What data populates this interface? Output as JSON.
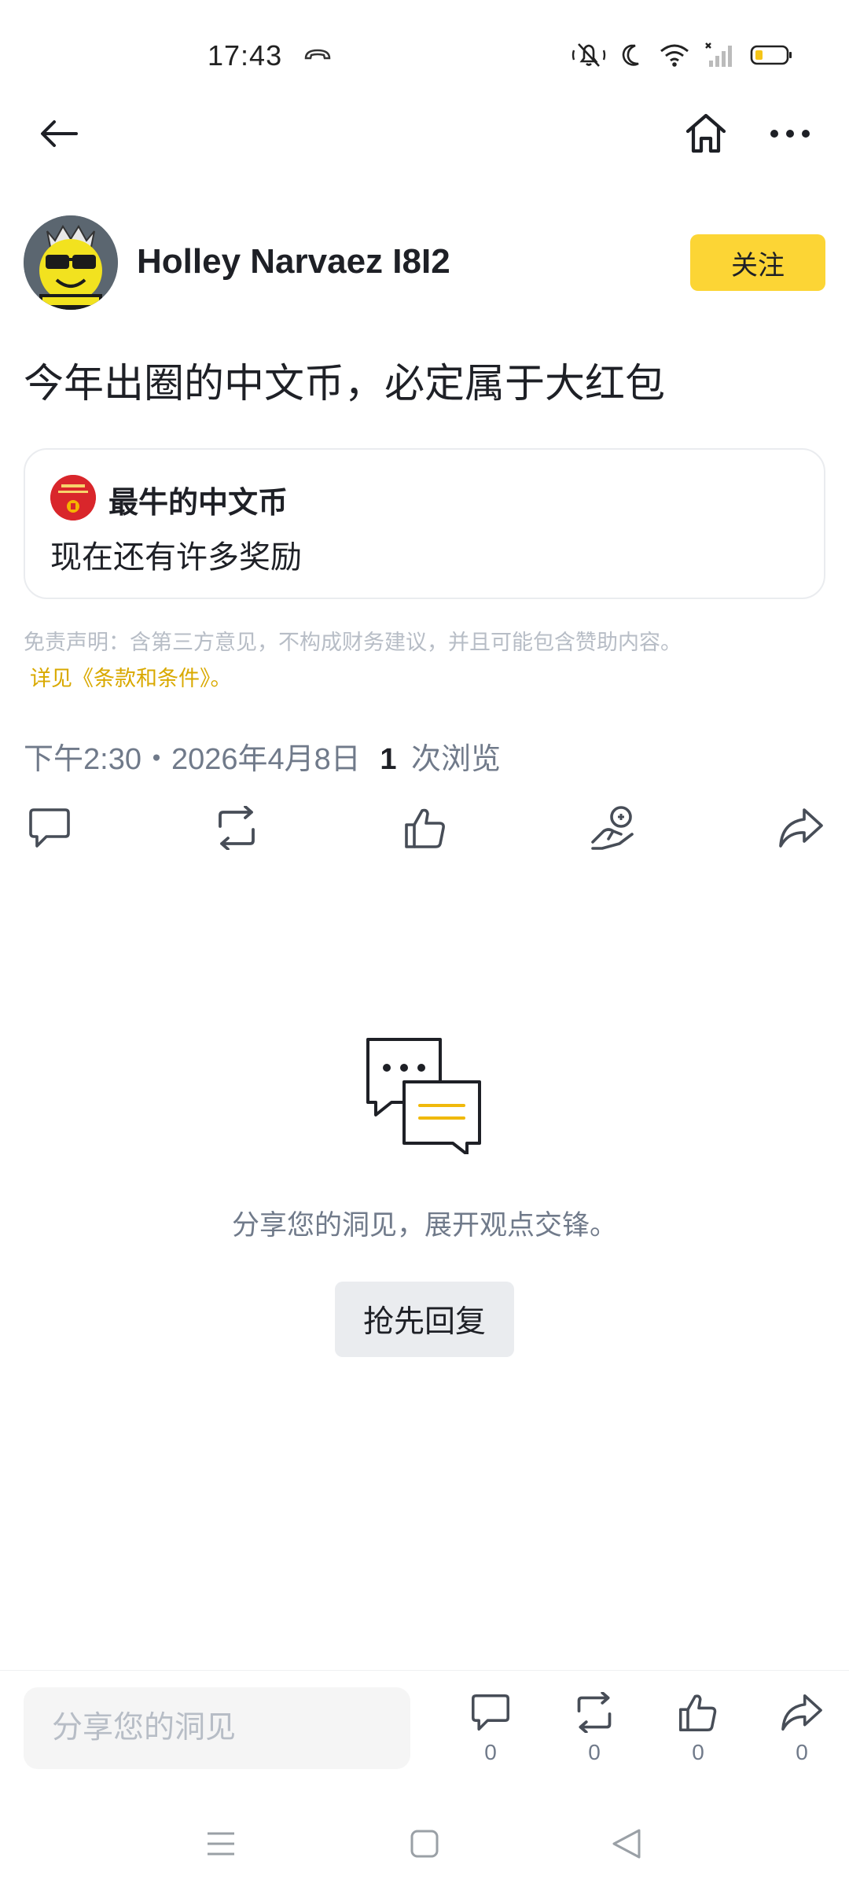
{
  "status_bar": {
    "time": "17:43",
    "icons": [
      "call-icon",
      "mute-icon",
      "moon-icon",
      "wifi-icon",
      "signal-icon",
      "battery-icon"
    ]
  },
  "top_bar": {
    "icons": [
      "back-arrow-icon",
      "home-icon",
      "more-icon"
    ]
  },
  "author": {
    "name": "Holley Narvaez I8I2",
    "follow_label": "关注"
  },
  "post": {
    "text": "今年出圈的中文币，必定属于大红包",
    "quote": {
      "title": "最牛的中文币",
      "subtitle": "现在还有许多奖励"
    },
    "disclaimer": "免责声明：含第三方意见，不构成财务建议，并且可能包含赞助内容。",
    "disclaimer_link": "详见《条款和条件》。",
    "timestamp": "下午2:30・2026年4月8日",
    "views_count": "1",
    "views_label": "次浏览"
  },
  "actions": [
    "comment-icon",
    "repost-icon",
    "like-icon",
    "tip-icon",
    "share-icon"
  ],
  "empty_state": {
    "text": "分享您的洞见，展开观点交锋。",
    "reply_label": "抢先回复"
  },
  "bottom_bar": {
    "input_placeholder": "分享您的洞见",
    "stats": [
      {
        "icon": "comment-icon",
        "count": "0"
      },
      {
        "icon": "repost-icon",
        "count": "0"
      },
      {
        "icon": "like-icon",
        "count": "0"
      },
      {
        "icon": "share-icon",
        "count": "0"
      }
    ]
  },
  "colors": {
    "accent": "#FCD535",
    "link": "#D9A900",
    "text_primary": "#1E2026",
    "text_secondary": "#707A8A",
    "text_muted": "#B7BDC6"
  }
}
